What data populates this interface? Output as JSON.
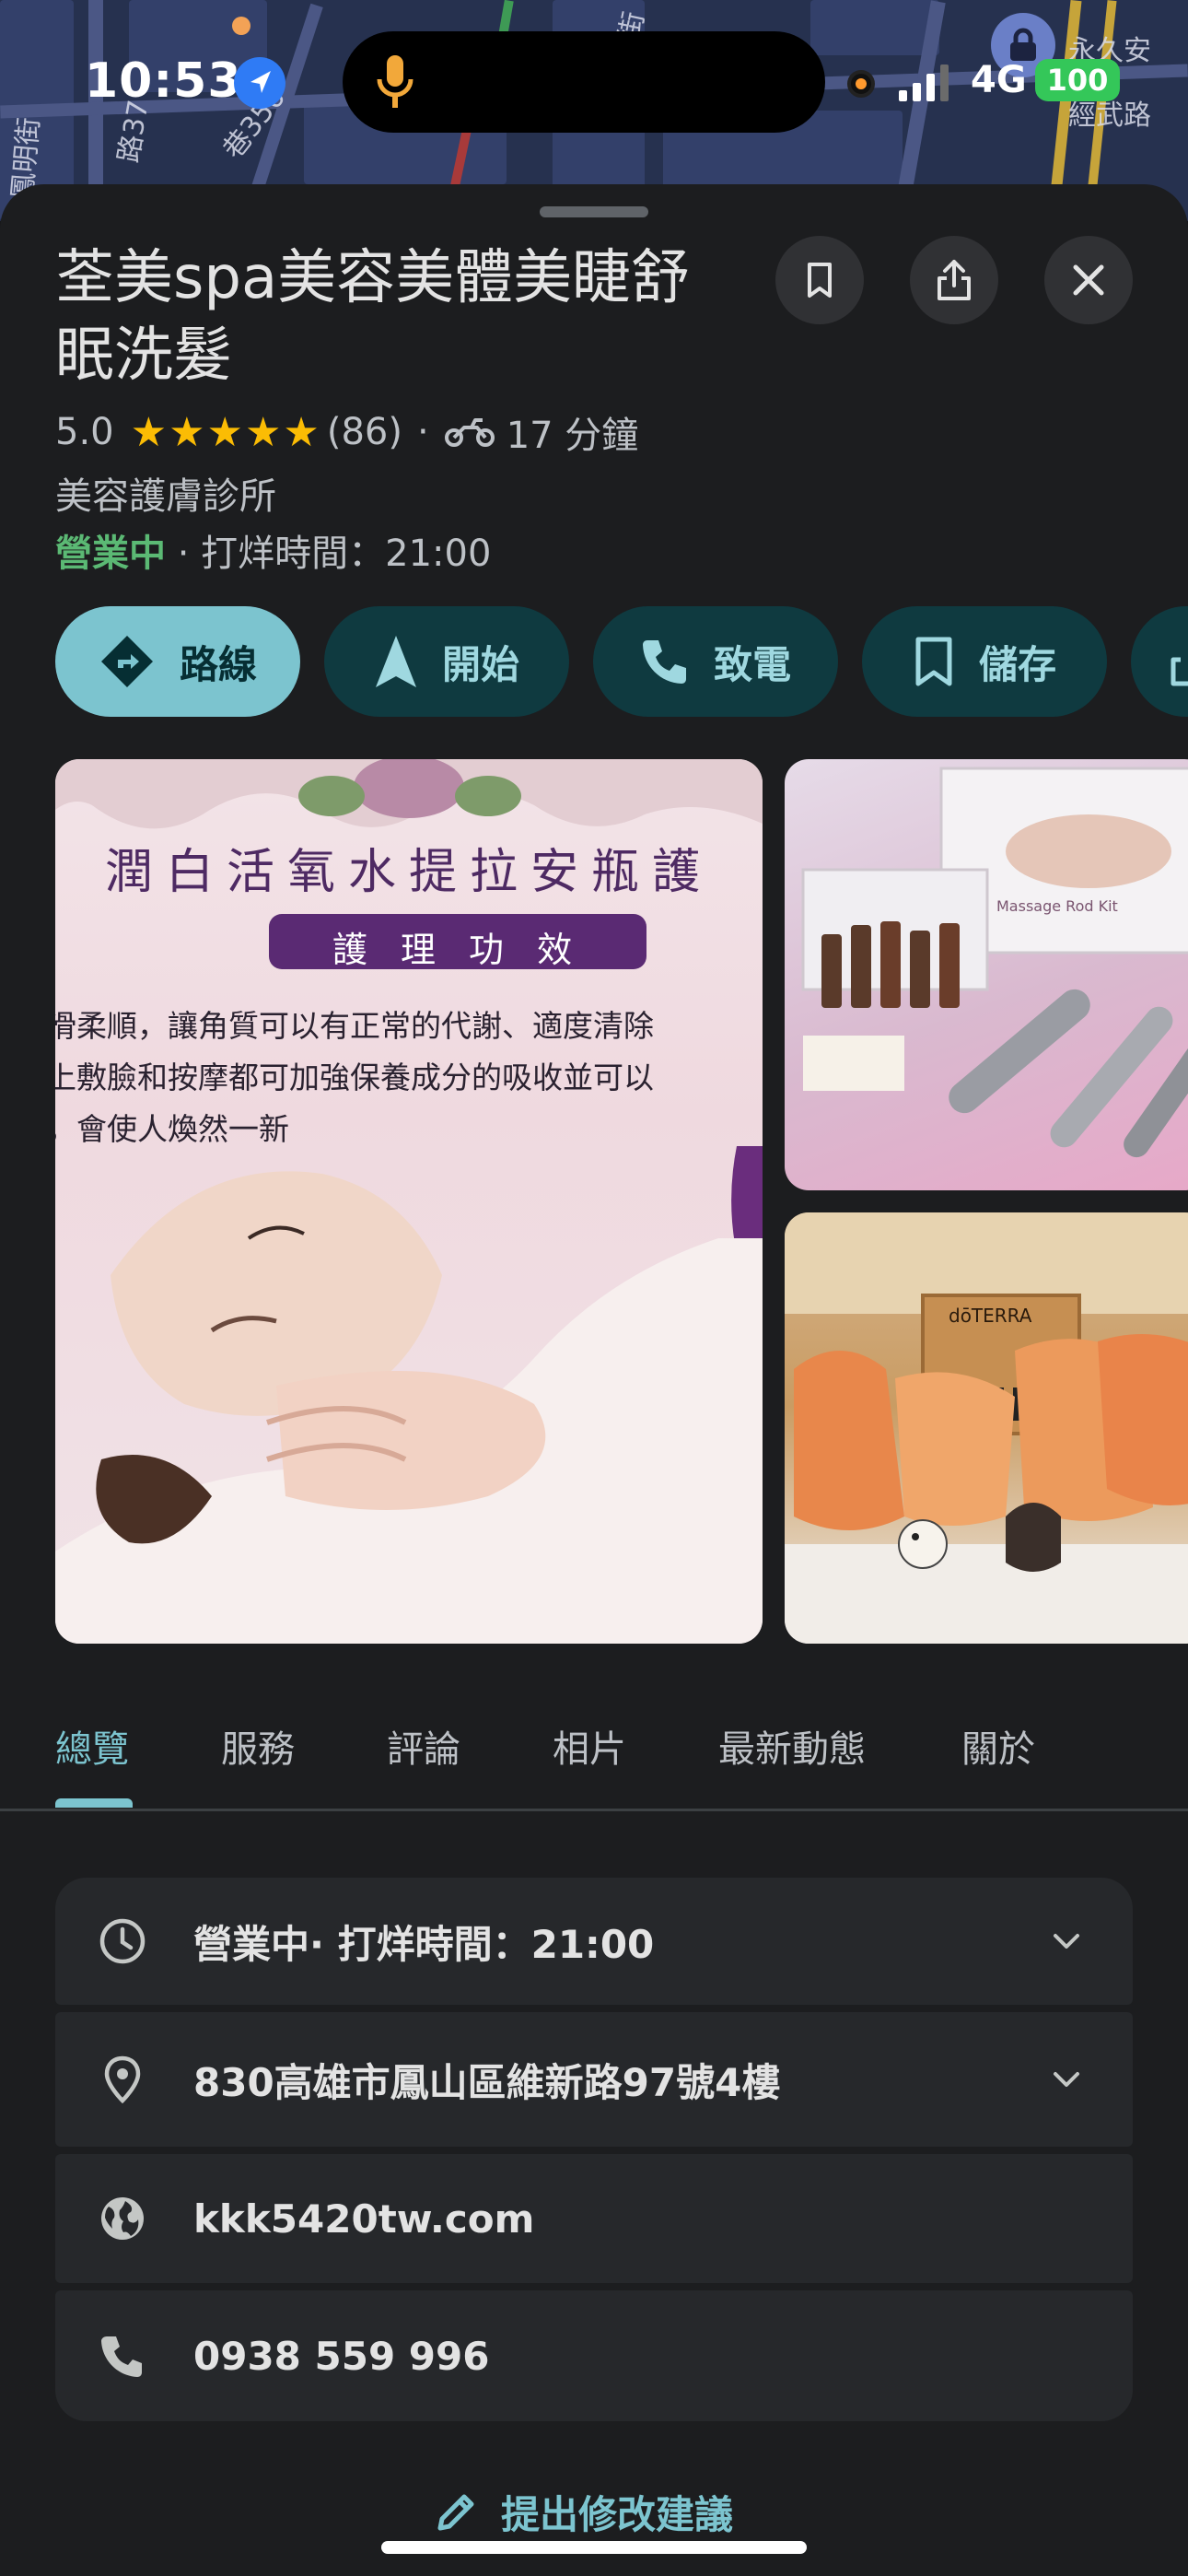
{
  "status_bar": {
    "time": "10:53",
    "network": "4G",
    "battery": "100"
  },
  "map": {
    "labels": [
      "路37",
      "巷356",
      "路街",
      "經武路",
      "永久安",
      "鳳明街"
    ]
  },
  "place": {
    "name": "荃美spa美容美體美睫舒眠洗髮",
    "rating": "5.0",
    "stars": "★★★★★",
    "review_count": "(86)",
    "separator": "·",
    "travel_time": "17 分鐘",
    "category": "美容護膚診所",
    "open_status": "營業中",
    "closing_text": " · 打烊時間：21:00"
  },
  "header_buttons": {
    "save_icon": "bookmark-icon",
    "share_icon": "share-icon",
    "close_icon": "close-icon"
  },
  "actions": [
    {
      "label": "路線",
      "icon": "directions-icon"
    },
    {
      "label": "開始",
      "icon": "navigation-arrow-icon"
    },
    {
      "label": "致電",
      "icon": "phone-icon"
    },
    {
      "label": "儲存",
      "icon": "bookmark-icon"
    }
  ],
  "photos": {
    "p1_banner_title": "潤白活氧水提拉安瓶護",
    "p1_ribbon": "護 理 功 效",
    "p1_lines": [
      "滑柔順，讓角質可以有正常的代謝、適度清除",
      "上敷臉和按摩都可加強保養成分的吸收並可以",
      "，會使人煥然一新"
    ],
    "p2_box_text": "Massage Rod Kit",
    "p3_box_text": "dōTERRA"
  },
  "tabs": [
    "總覽",
    "服務",
    "評論",
    "相片",
    "最新動態",
    "關於"
  ],
  "active_tab": "總覽",
  "info": {
    "hours_open": "營業中",
    "hours_rest": " · 打烊時間：21:00",
    "address": "830高雄市鳳山區維新路97號4樓",
    "website": "kkk5420tw.com",
    "phone": "0938 559 996"
  },
  "suggest_edit": "提出修改建議",
  "colors": {
    "accent": "#7cc4cf",
    "chip_bg": "#0f3a40",
    "open_green": "#5bb974",
    "star_yellow": "#fbbc04",
    "sheet_bg": "#1c1d1f",
    "card_bg": "#26282b"
  }
}
